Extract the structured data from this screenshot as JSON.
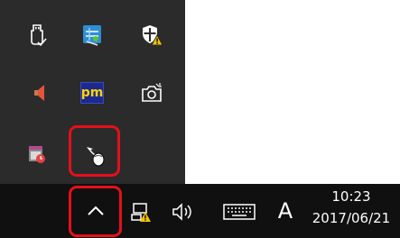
{
  "colors": {
    "flyout_bg": "#2b2b2b",
    "taskbar_bg": "#101010",
    "highlight": "#e4101b"
  },
  "tray_flyout": {
    "icons": [
      {
        "name": "usb-eject-icon"
      },
      {
        "name": "network-config-icon"
      },
      {
        "name": "security-shield-warning-icon"
      },
      {
        "name": "speaker-icon"
      },
      {
        "name": "pm-app-icon",
        "label": "pm"
      },
      {
        "name": "camera-icon"
      },
      {
        "name": "calendar-clock-icon"
      },
      {
        "name": "mouse-icon"
      }
    ]
  },
  "taskbar": {
    "show_hidden_icons": {
      "icon": "chevron-up-icon"
    },
    "network_icon": "network-warning-icon",
    "volume_icon": "volume-icon",
    "keyboard_icon": "touch-keyboard-icon",
    "ime_mode": "A",
    "clock": {
      "time": "10:23",
      "date": "2017/06/21"
    }
  }
}
